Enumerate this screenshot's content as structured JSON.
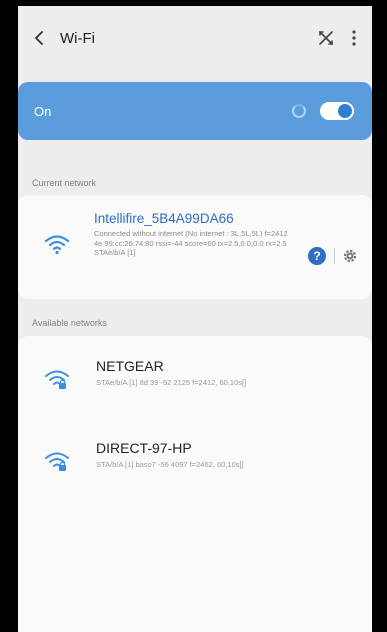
{
  "header": {
    "title": "Wi-Fi"
  },
  "toggle": {
    "label": "On",
    "state": "on"
  },
  "sections": {
    "current": "Current network",
    "available": "Available networks"
  },
  "current_network": {
    "name": "Intellifire_5B4A99DA66",
    "detail": "Connected without internet (No internet : 3L,5L,5L) f=2412 4e 99:cc:26:74:80 rssi=-44 score=60 tx=2.5,0.0,0.0 rx=2.5 STAe/b/A [1]"
  },
  "available_networks": [
    {
      "name": "NETGEAR",
      "detail": "STAe/b/A [1] 8d:39 -52 2125 f=2412, 60,10s[]",
      "icon": "wifi-lock-icon"
    },
    {
      "name": "DIRECT-97-HP",
      "detail": "STA/b/A [1] baso7 -56 4097 f=2462, 60,10s[]",
      "icon": "wifi-lock-icon"
    }
  ],
  "colors": {
    "accent": "#5b9ddc",
    "link": "#2c6dc4",
    "background": "#ededed",
    "card": "#fafafa"
  }
}
